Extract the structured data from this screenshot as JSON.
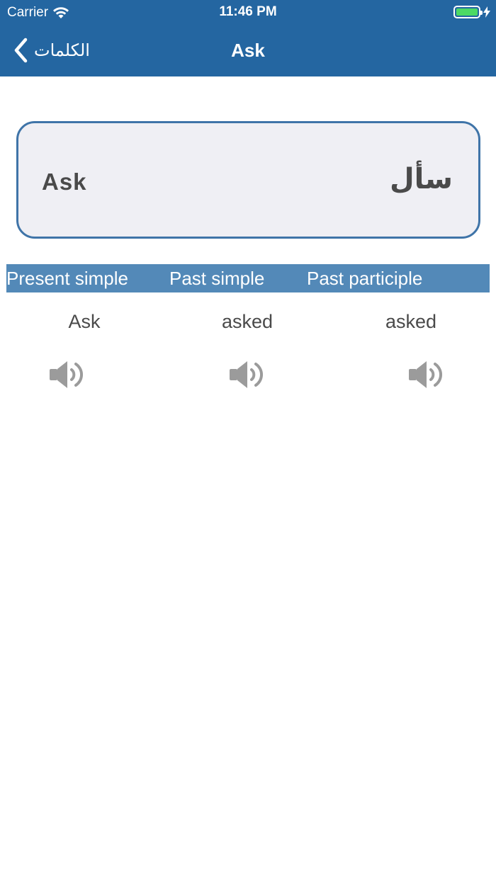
{
  "status_bar": {
    "carrier": "Carrier",
    "time": "11:46 PM",
    "battery_color": "#4cd964"
  },
  "nav": {
    "back_label": "الكلمات",
    "title": "Ask",
    "background": "#2466a1"
  },
  "card": {
    "english": "Ask",
    "arabic": "سأل",
    "border_color": "#3f74a8",
    "background": "#efeff4"
  },
  "table": {
    "header_color": "#5389b8",
    "columns": [
      "Present simple",
      "Past simple",
      "Past participle"
    ],
    "values": [
      "Ask",
      "asked",
      "asked"
    ]
  },
  "icons": {
    "back": "chevron-left-icon",
    "wifi": "wifi-icon",
    "battery": "battery-icon",
    "speaker": "speaker-icon"
  }
}
